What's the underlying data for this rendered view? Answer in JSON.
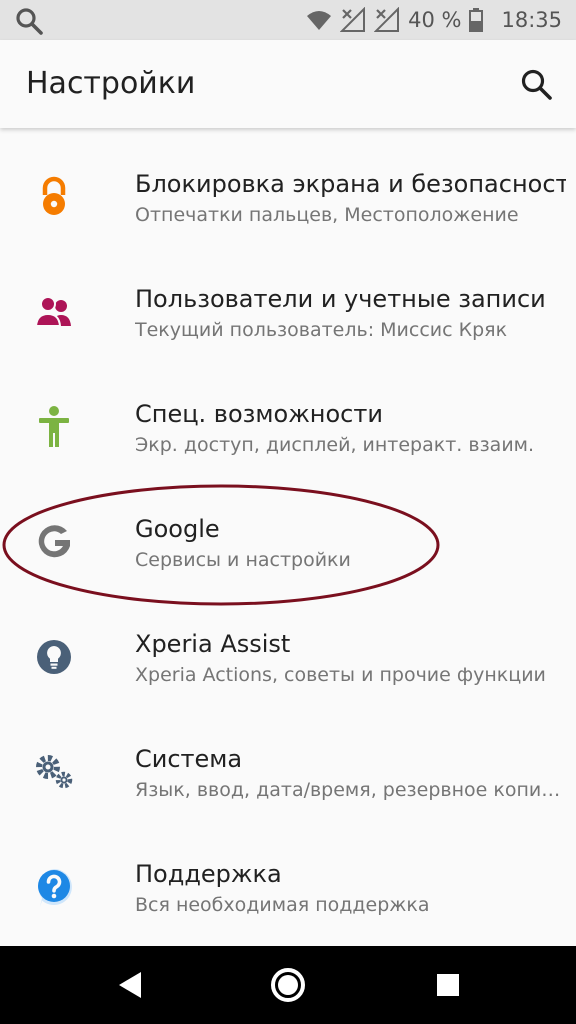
{
  "status_bar": {
    "battery_percent": "40 %",
    "time": "18:35",
    "icons": [
      "search-icon",
      "wifi-icon",
      "signal-no-service-icon",
      "signal-no-service-icon",
      "battery-icon"
    ]
  },
  "app_bar": {
    "title": "Настройки",
    "search_icon": "search-icon"
  },
  "settings": {
    "items": [
      {
        "icon": "lock-icon",
        "icon_color": "#f57c00",
        "title": "Блокировка экрана и безопасность",
        "subtitle": "Отпечатки пальцев, Местоположение"
      },
      {
        "icon": "users-icon",
        "icon_color": "#ad1457",
        "title": "Пользователи и учетные записи",
        "subtitle": "Текущий пользователь: Миссис Кряк"
      },
      {
        "icon": "accessibility-icon",
        "icon_color": "#7cb342",
        "title": "Спец. возможности",
        "subtitle": "Экр. доступ, дисплей, интеракт. взаим."
      },
      {
        "icon": "google-icon",
        "icon_color": "#757575",
        "title": "Google",
        "subtitle": "Сервисы и настройки"
      },
      {
        "icon": "lightbulb-icon",
        "icon_color": "#4a6078",
        "title": "Xperia Assist",
        "subtitle": "Xperia Actions, советы и прочие функции"
      },
      {
        "icon": "gears-icon",
        "icon_color": "#4a6078",
        "title": "Система",
        "subtitle": "Язык, ввод, дата/время, резервное копирование"
      },
      {
        "icon": "help-icon",
        "icon_color": "#1e88e5",
        "title": "Поддержка",
        "subtitle": "Вся необходимая поддержка"
      }
    ]
  },
  "annotation": {
    "highlight_color": "#7a0f1e"
  },
  "nav_bar": {
    "icons": [
      "back-icon",
      "home-icon",
      "recents-icon"
    ]
  }
}
